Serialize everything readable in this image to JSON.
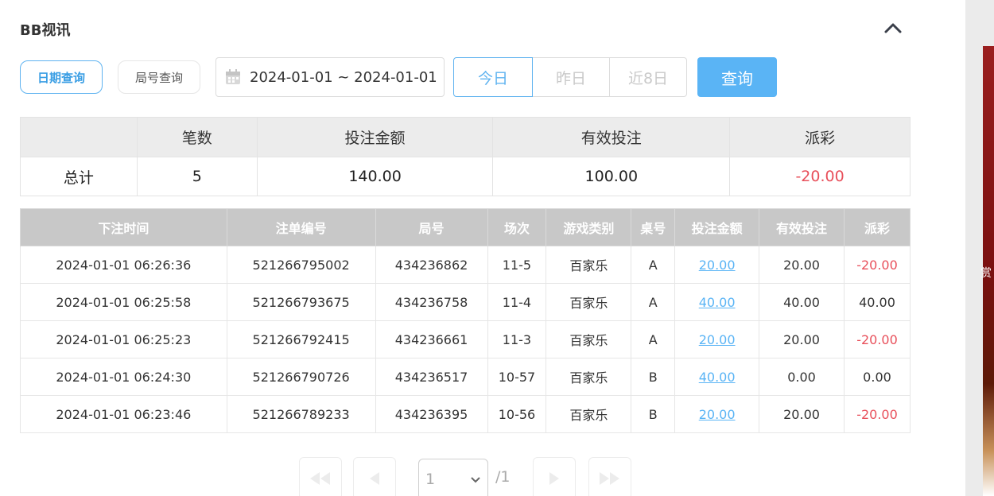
{
  "header": {
    "title": "BB视讯"
  },
  "tabs": {
    "date_query": "日期查询",
    "round_query": "局号查询"
  },
  "date_range": {
    "value": "2024-01-01 ~ 2024-01-01"
  },
  "quick_filters": {
    "today": "今日",
    "yesterday": "昨日",
    "last8": "近8日"
  },
  "search_button": "查询",
  "summary": {
    "headers": [
      "",
      "笔数",
      "投注金额",
      "有效投注",
      "派彩"
    ],
    "row_label": "总计",
    "count": "5",
    "bet_amount": "140.00",
    "valid_bet": "100.00",
    "payout": "-20.00"
  },
  "records": {
    "headers": [
      "下注时间",
      "注单编号",
      "局号",
      "场次",
      "游戏类别",
      "桌号",
      "投注金额",
      "有效投注",
      "派彩"
    ],
    "rows": [
      {
        "time": "2024-01-01 06:26:36",
        "bet_no": "521266795002",
        "round": "434236862",
        "session": "11-5",
        "game": "百家乐",
        "table": "A",
        "amount": "20.00",
        "valid": "20.00",
        "payout": "-20.00",
        "negative": true
      },
      {
        "time": "2024-01-01 06:25:58",
        "bet_no": "521266793675",
        "round": "434236758",
        "session": "11-4",
        "game": "百家乐",
        "table": "A",
        "amount": "40.00",
        "valid": "40.00",
        "payout": "40.00",
        "negative": false
      },
      {
        "time": "2024-01-01 06:25:23",
        "bet_no": "521266792415",
        "round": "434236661",
        "session": "11-3",
        "game": "百家乐",
        "table": "A",
        "amount": "20.00",
        "valid": "20.00",
        "payout": "-20.00",
        "negative": true
      },
      {
        "time": "2024-01-01 06:24:30",
        "bet_no": "521266790726",
        "round": "434236517",
        "session": "10-57",
        "game": "百家乐",
        "table": "B",
        "amount": "40.00",
        "valid": "0.00",
        "payout": "0.00",
        "negative": false
      },
      {
        "time": "2024-01-01 06:23:46",
        "bet_no": "521266789233",
        "round": "434236395",
        "session": "10-56",
        "game": "百家乐",
        "table": "B",
        "amount": "20.00",
        "valid": "20.00",
        "payout": "-20.00",
        "negative": true
      }
    ]
  },
  "pagination": {
    "current_page": "1",
    "total": "/1"
  },
  "side_panel": {
    "text": "赏"
  },
  "colors": {
    "accent": "#5ab4f5",
    "negative": "#e8505b",
    "header_gray": "#c8c8c8"
  }
}
